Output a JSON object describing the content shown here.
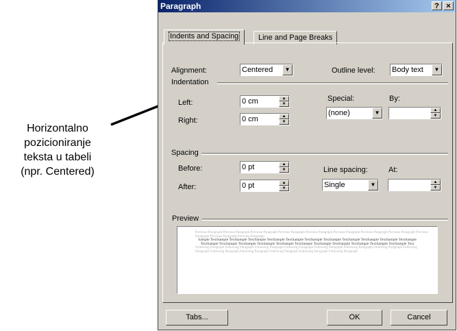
{
  "annotation": {
    "text": "Horizontalno\npozicioniranje\nteksta u tabeli\n(npr. Centered)"
  },
  "dialog": {
    "title": "Paragraph",
    "help_label": "?",
    "close_label": "×",
    "tabs": [
      {
        "label": "Indents and Spacing",
        "active": true
      },
      {
        "label": "Line and Page Breaks",
        "active": false
      }
    ],
    "alignment": {
      "label": "Alignment:",
      "value": "Centered"
    },
    "outline_level": {
      "label": "Outline level:",
      "value": "Body text"
    },
    "indentation": {
      "group_label": "Indentation",
      "left": {
        "label": "Left:",
        "value": "0 cm"
      },
      "right": {
        "label": "Right:",
        "value": "0 cm"
      },
      "special": {
        "label": "Special:",
        "value": "(none)"
      },
      "by": {
        "label": "By:",
        "value": ""
      }
    },
    "spacing": {
      "group_label": "Spacing",
      "before": {
        "label": "Before:",
        "value": "0 pt"
      },
      "after": {
        "label": "After:",
        "value": "0 pt"
      },
      "line_spacing": {
        "label": "Line spacing:",
        "value": "Single"
      },
      "at": {
        "label": "At:",
        "value": ""
      }
    },
    "preview": {
      "group_label": "Preview",
      "previous_text": "Previous Paragraph Previous Paragraph Previous Paragraph Previous Paragraph Previous Paragraph Previous Paragraph Previous Paragraph Previous Paragraph Previous Paragraph Previous Paragraph Previous Paragraph",
      "sample_text": "Sample TextSample TextSample TextSample TextSample TextSample TextSample TextSample TextSample TextSample TextSample TextSample TextSample TextSample TextSample TextSample TextSample TextSample TextSample TextSample TextSample TextSample TextSample Text",
      "following_text": "Following Paragraph Following Paragraph Following Paragraph Following Paragraph Following Paragraph Following Paragraph Following Paragraph Following Paragraph Following Paragraph Following Paragraph Following Paragraph Following Paragraph Following Paragraph"
    },
    "buttons": {
      "tabs": "Tabs...",
      "ok": "OK",
      "cancel": "Cancel"
    }
  }
}
